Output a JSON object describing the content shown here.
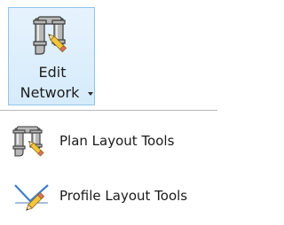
{
  "ribbon": {
    "edit_network": {
      "label_line1": "Edit",
      "label_line2": "Network",
      "icon": "edit-network-pipe-pencil-icon"
    }
  },
  "menu": {
    "items": [
      {
        "label": "Plan Layout Tools",
        "icon": "plan-layout-pipe-pencil-icon"
      },
      {
        "label": "Profile Layout Tools",
        "icon": "profile-layout-pencil-icon"
      }
    ]
  },
  "colors": {
    "ribbon_bg": "#d6ebfb",
    "ribbon_border": "#8fc6ea",
    "pipe": "#b3b3b3",
    "pencil": "#f2c53d"
  }
}
